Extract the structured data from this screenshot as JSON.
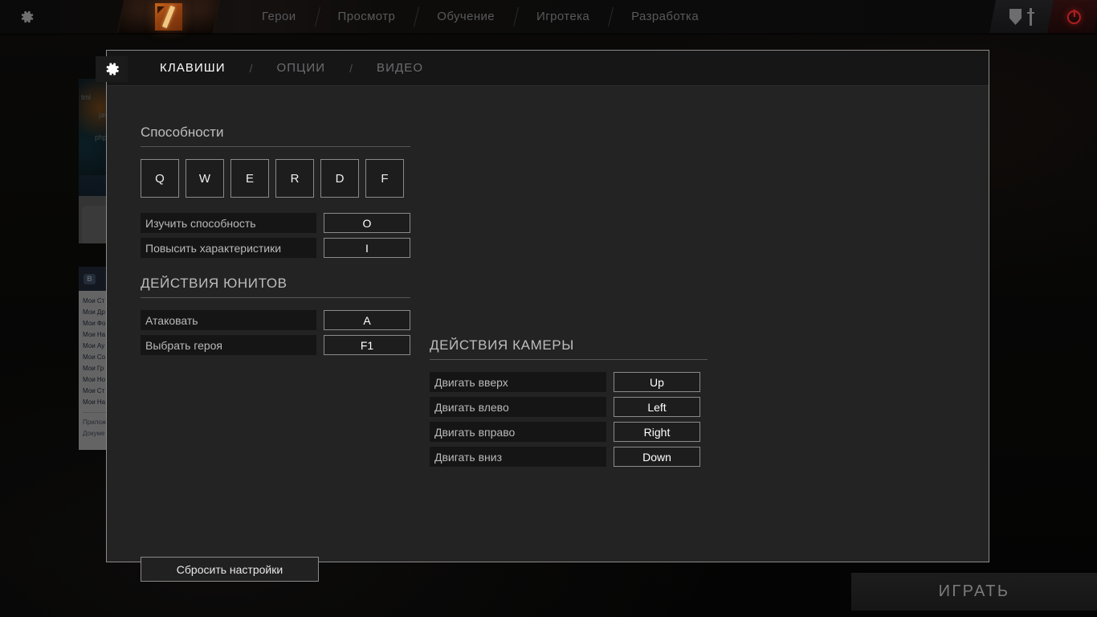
{
  "topnav": {
    "gear_icon": "gear-icon",
    "logo": "dota2-logo",
    "items": [
      {
        "label": "Герои"
      },
      {
        "label": "Просмотр"
      },
      {
        "label": "Обучение"
      },
      {
        "label": "Игротека"
      },
      {
        "label": "Разработка"
      }
    ],
    "badge_icons": [
      "shield-icon",
      "sword-icon"
    ],
    "power_icon": "power-icon"
  },
  "dialog": {
    "gear_icon": "settings-gear-icon",
    "tabs": [
      {
        "label": "КЛАВИШИ",
        "active": true
      },
      {
        "label": "ОПЦИИ",
        "active": false
      },
      {
        "label": "ВИДЕО",
        "active": false
      }
    ],
    "tab_separator": "/",
    "abilities": {
      "title": "Способности",
      "keys": [
        "Q",
        "W",
        "E",
        "R",
        "D",
        "F"
      ],
      "bindings": [
        {
          "label": "Изучить способность",
          "key": "O"
        },
        {
          "label": "Повысить характеристики",
          "key": "I"
        }
      ]
    },
    "unit_actions": {
      "title": "ДЕЙСТВИЯ ЮНИТОВ",
      "bindings": [
        {
          "label": "Атаковать",
          "key": "A"
        },
        {
          "label": "Выбрать героя",
          "key": "F1"
        }
      ]
    },
    "camera_actions": {
      "title": "ДЕЙСТВИЯ КАМЕРЫ",
      "bindings": [
        {
          "label": "Двигать вверх",
          "key": "Up"
        },
        {
          "label": "Двигать влево",
          "key": "Left"
        },
        {
          "label": "Двигать вправо",
          "key": "Right"
        },
        {
          "label": "Двигать вниз",
          "key": "Down"
        }
      ]
    },
    "reset_label": "Сбросить настройки"
  },
  "play_button": {
    "label": "ИГРАТЬ"
  },
  "background_windows": {
    "browser": {
      "tags": [
        "tml",
        "jav",
        "php"
      ],
      "foot_icons": [
        "download-icon",
        "download-icon"
      ]
    },
    "vk": {
      "logo": "B",
      "items": [
        "Мои Ст",
        "Мои Др",
        "Мои Фо",
        "Мои На",
        "Мои Ау",
        "Мои Со",
        "Мои Гр",
        "Мои Но",
        "Мои Ст",
        "Мои На"
      ],
      "footer_items": [
        "Прилож",
        "Докуме"
      ]
    }
  },
  "colors": {
    "accent_orange": "#c4641a",
    "power_red": "#b02020",
    "panel_bg": "#232324",
    "panel_border": "#8c8c8c",
    "text_primary": "#ffffff",
    "text_muted": "#6d6d6f"
  }
}
